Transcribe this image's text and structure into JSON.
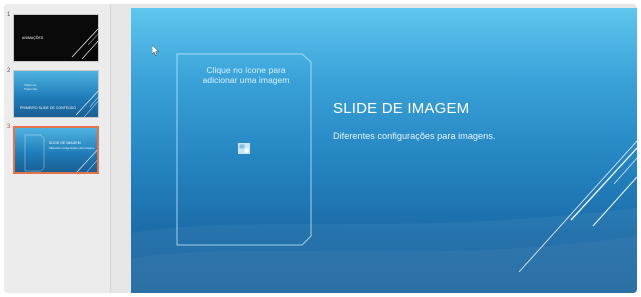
{
  "thumbnails": [
    {
      "number": "1",
      "title": "ANIMAÇÕES",
      "bullets": []
    },
    {
      "number": "2",
      "title": "PRIMEIRO SLIDE DE CONTEÚDO",
      "bullets": [
        "Tópico um",
        "Tópico dois"
      ]
    },
    {
      "number": "3",
      "title": "SLIDE DE IMAGEM",
      "bullets": [
        "Diferentes configurações para imagens."
      ]
    }
  ],
  "slide": {
    "placeholder_line1": "Clique no ícone para",
    "placeholder_line2": "adicionar uma imagem",
    "title": "SLIDE DE IMAGEM",
    "subtitle": "Diferentes configurações para imagens."
  },
  "colors": {
    "slide_top": "#5fc6ee",
    "slide_bottom": "#18649e",
    "selection_accent": "#e2744a"
  },
  "icons": {
    "placeholder": "picture-icon",
    "pointer": "cursor-arrow-icon"
  }
}
